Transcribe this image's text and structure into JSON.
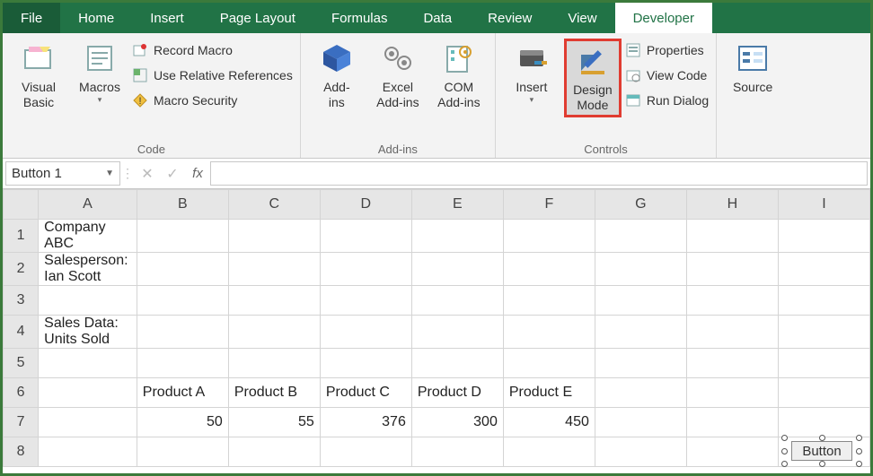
{
  "tabs": [
    "File",
    "Home",
    "Insert",
    "Page Layout",
    "Formulas",
    "Data",
    "Review",
    "View",
    "Developer"
  ],
  "active_tab": "Developer",
  "ribbon": {
    "code": {
      "visual_basic": "Visual\nBasic",
      "macros": "Macros",
      "record": "Record Macro",
      "relative": "Use Relative References",
      "security": "Macro Security",
      "label": "Code"
    },
    "addins": {
      "addins": "Add-\nins",
      "excel_addins": "Excel\nAdd-ins",
      "com_addins": "COM\nAdd-ins",
      "label": "Add-ins"
    },
    "controls": {
      "insert": "Insert",
      "design_mode": "Design\nMode",
      "properties": "Properties",
      "view_code": "View Code",
      "run_dialog": "Run Dialog",
      "label": "Controls"
    },
    "xml": {
      "source": "Source"
    }
  },
  "namebox": "Button 1",
  "formula": "",
  "columns": [
    "A",
    "B",
    "C",
    "D",
    "E",
    "F",
    "G",
    "H",
    "I"
  ],
  "rows": {
    "1": {
      "A": "Company ABC"
    },
    "2": {
      "A": "Salesperson: Ian Scott"
    },
    "3": {},
    "4": {
      "A": "Sales Data: Units Sold"
    },
    "5": {},
    "6": {
      "B": "Product A",
      "C": "Product B",
      "D": "Product C",
      "E": "Product D",
      "F": "Product E"
    },
    "7": {
      "B": "50",
      "C": "55",
      "D": "376",
      "E": "300",
      "F": "450"
    },
    "8": {}
  },
  "row_ids": [
    "1",
    "2",
    "3",
    "4",
    "5",
    "6",
    "7",
    "8"
  ],
  "button_overlay": "Button"
}
